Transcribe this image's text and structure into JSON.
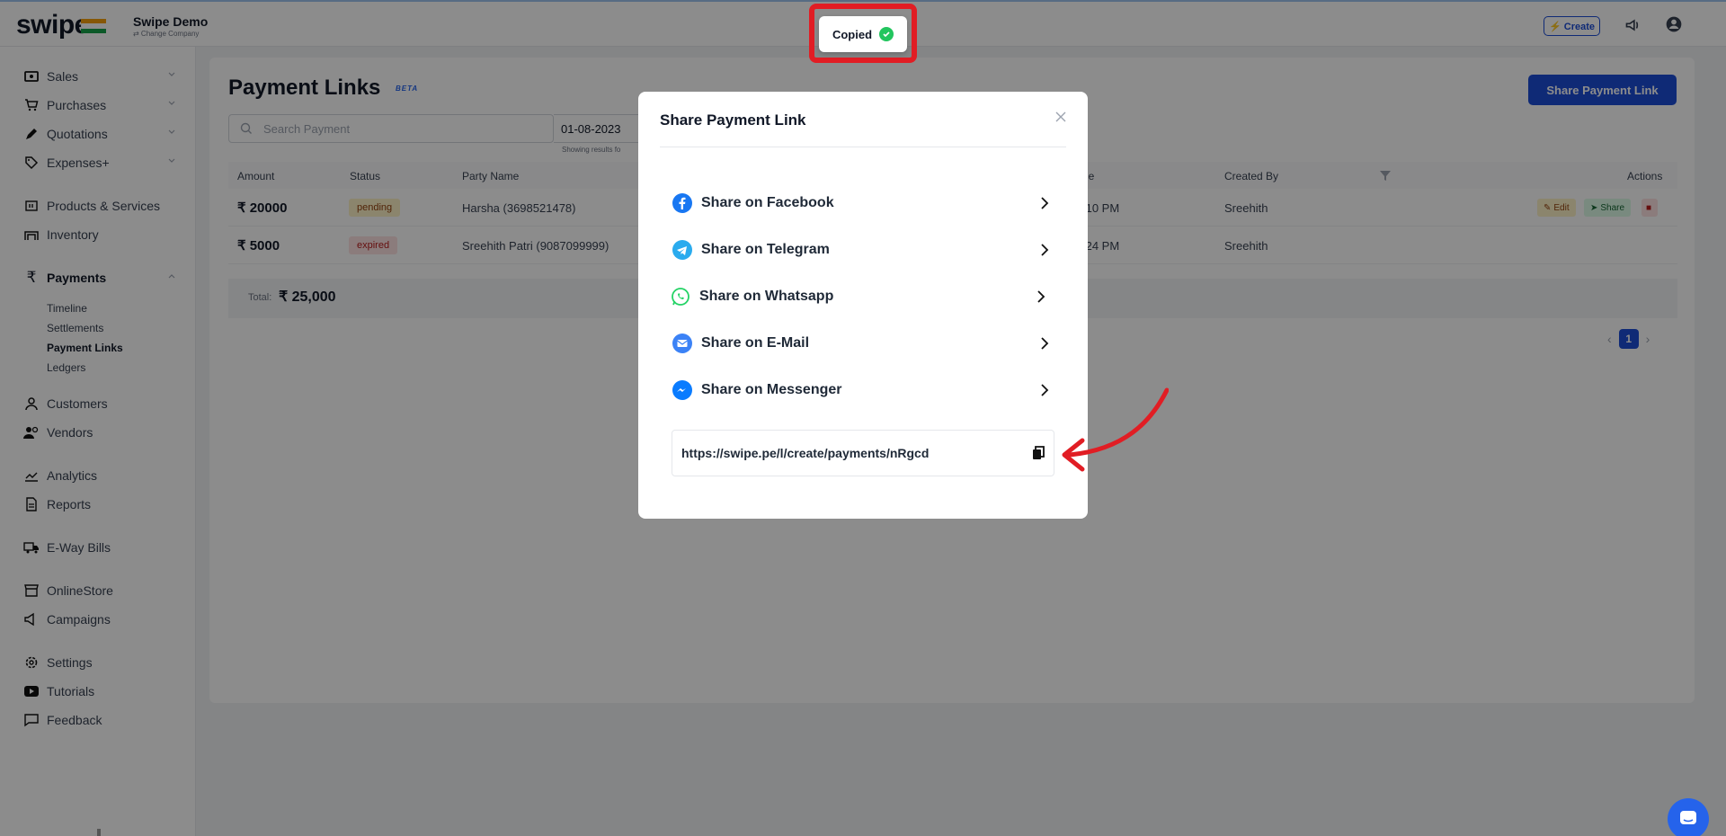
{
  "topbar": {
    "logo": "swipe",
    "company_name": "Swipe Demo",
    "change_company": "⇄ Change Company",
    "create_label": "⚡ Create"
  },
  "sidebar": {
    "items": [
      {
        "label": "Sales",
        "icon": "cash-icon"
      },
      {
        "label": "Purchases",
        "icon": "cart-icon"
      },
      {
        "label": "Quotations",
        "icon": "pen-icon"
      },
      {
        "label": "Expenses+",
        "icon": "tag-icon"
      },
      {
        "label": "Products & Services",
        "icon": "box-icon"
      },
      {
        "label": "Inventory",
        "icon": "warehouse-icon"
      },
      {
        "label": "Payments",
        "icon": "rupee-icon"
      },
      {
        "label": "Customers",
        "icon": "user-icon"
      },
      {
        "label": "Vendors",
        "icon": "users-icon"
      },
      {
        "label": "Analytics",
        "icon": "chart-icon"
      },
      {
        "label": "Reports",
        "icon": "report-icon"
      },
      {
        "label": "E-Way Bills",
        "icon": "truck-icon"
      },
      {
        "label": "OnlineStore",
        "icon": "store-icon"
      },
      {
        "label": "Campaigns",
        "icon": "megaphone-icon"
      },
      {
        "label": "Settings",
        "icon": "gear-icon"
      },
      {
        "label": "Tutorials",
        "icon": "youtube-icon"
      },
      {
        "label": "Feedback",
        "icon": "message-icon"
      }
    ],
    "payments_sub": [
      "Timeline",
      "Settlements",
      "Payment Links",
      "Ledgers"
    ]
  },
  "main": {
    "title": "Payment Links",
    "beta": "BETA",
    "share_button": "Share Payment Link",
    "search_placeholder": "Search Payment",
    "date": "01-08-2023",
    "showing": "Showing results fo",
    "columns": [
      "Amount",
      "Status",
      "Party Name",
      "ne",
      "Created By",
      "Actions"
    ],
    "rows": [
      {
        "amount": "₹ 20000",
        "status": "pending",
        "party": "Harsha (3698521478)",
        "time": ":10 PM",
        "created_by": "Sreehith"
      },
      {
        "amount": "₹ 5000",
        "status": "expired",
        "party": "Sreehith Patri (9087099999)",
        "time": ":24 PM",
        "created_by": "Sreehith"
      }
    ],
    "actions": {
      "edit": "Edit",
      "share": "Share"
    },
    "total_label": "Total:",
    "total_value": "₹ 25,000",
    "page": "1"
  },
  "modal": {
    "title": "Share Payment Link",
    "options": [
      {
        "label": "Share on Facebook",
        "icon": "facebook-icon",
        "color": "#1877f2"
      },
      {
        "label": "Share on Telegram",
        "icon": "telegram-icon",
        "color": "#2aabee"
      },
      {
        "label": "Share on Whatsapp",
        "icon": "whatsapp-icon",
        "color": "#25d366"
      },
      {
        "label": "Share on E-Mail",
        "icon": "email-icon",
        "color": "#3b82f6"
      },
      {
        "label": "Share on Messenger",
        "icon": "messenger-icon",
        "color": "#0a7cff"
      }
    ],
    "link": "https://swipe.pe/l/create/payments/nRgcd"
  },
  "toast": {
    "label": "Copied"
  },
  "colors": {
    "accent": "#1d4ed8",
    "highlight": "#e11d24",
    "success": "#22c55e"
  }
}
